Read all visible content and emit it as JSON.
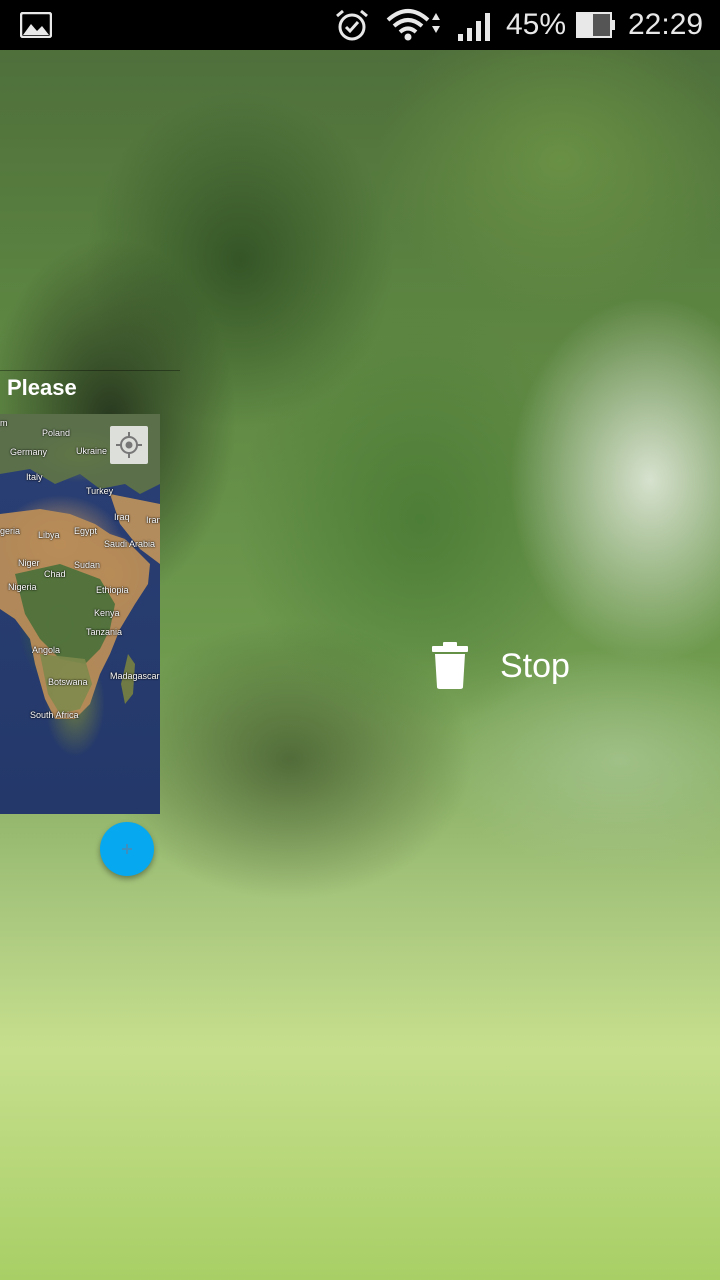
{
  "status_bar": {
    "battery_percent": "45%",
    "time": "22:29",
    "icons": [
      "gallery-notification-icon",
      "alarm-icon",
      "wifi-icon",
      "signal-icon",
      "battery-icon"
    ]
  },
  "recent_app_card": {
    "title": "Please",
    "map_labels": {
      "poland": "Poland",
      "germany": "Germany",
      "ukraine": "Ukraine",
      "italy": "Italy",
      "turkey": "Turkey",
      "iraq": "Iraq",
      "iran": "Iran",
      "algeria": "geria",
      "libya": "Libya",
      "egypt": "Egypt",
      "saudi_arabia": "Saudi Arabia",
      "niger": "Niger",
      "chad": "Chad",
      "sudan": "Sudan",
      "nigeria": "Nigeria",
      "ethiopia": "Ethiopia",
      "kenya": "Kenya",
      "tanzania": "Tanzania",
      "angola": "Angola",
      "madagascar": "Madagascar",
      "botswana": "Botswana",
      "south_africa": "South Africa"
    },
    "fab_color": "#06a8f0"
  },
  "stop_action": {
    "label": "Stop",
    "icon": "trash-icon"
  }
}
